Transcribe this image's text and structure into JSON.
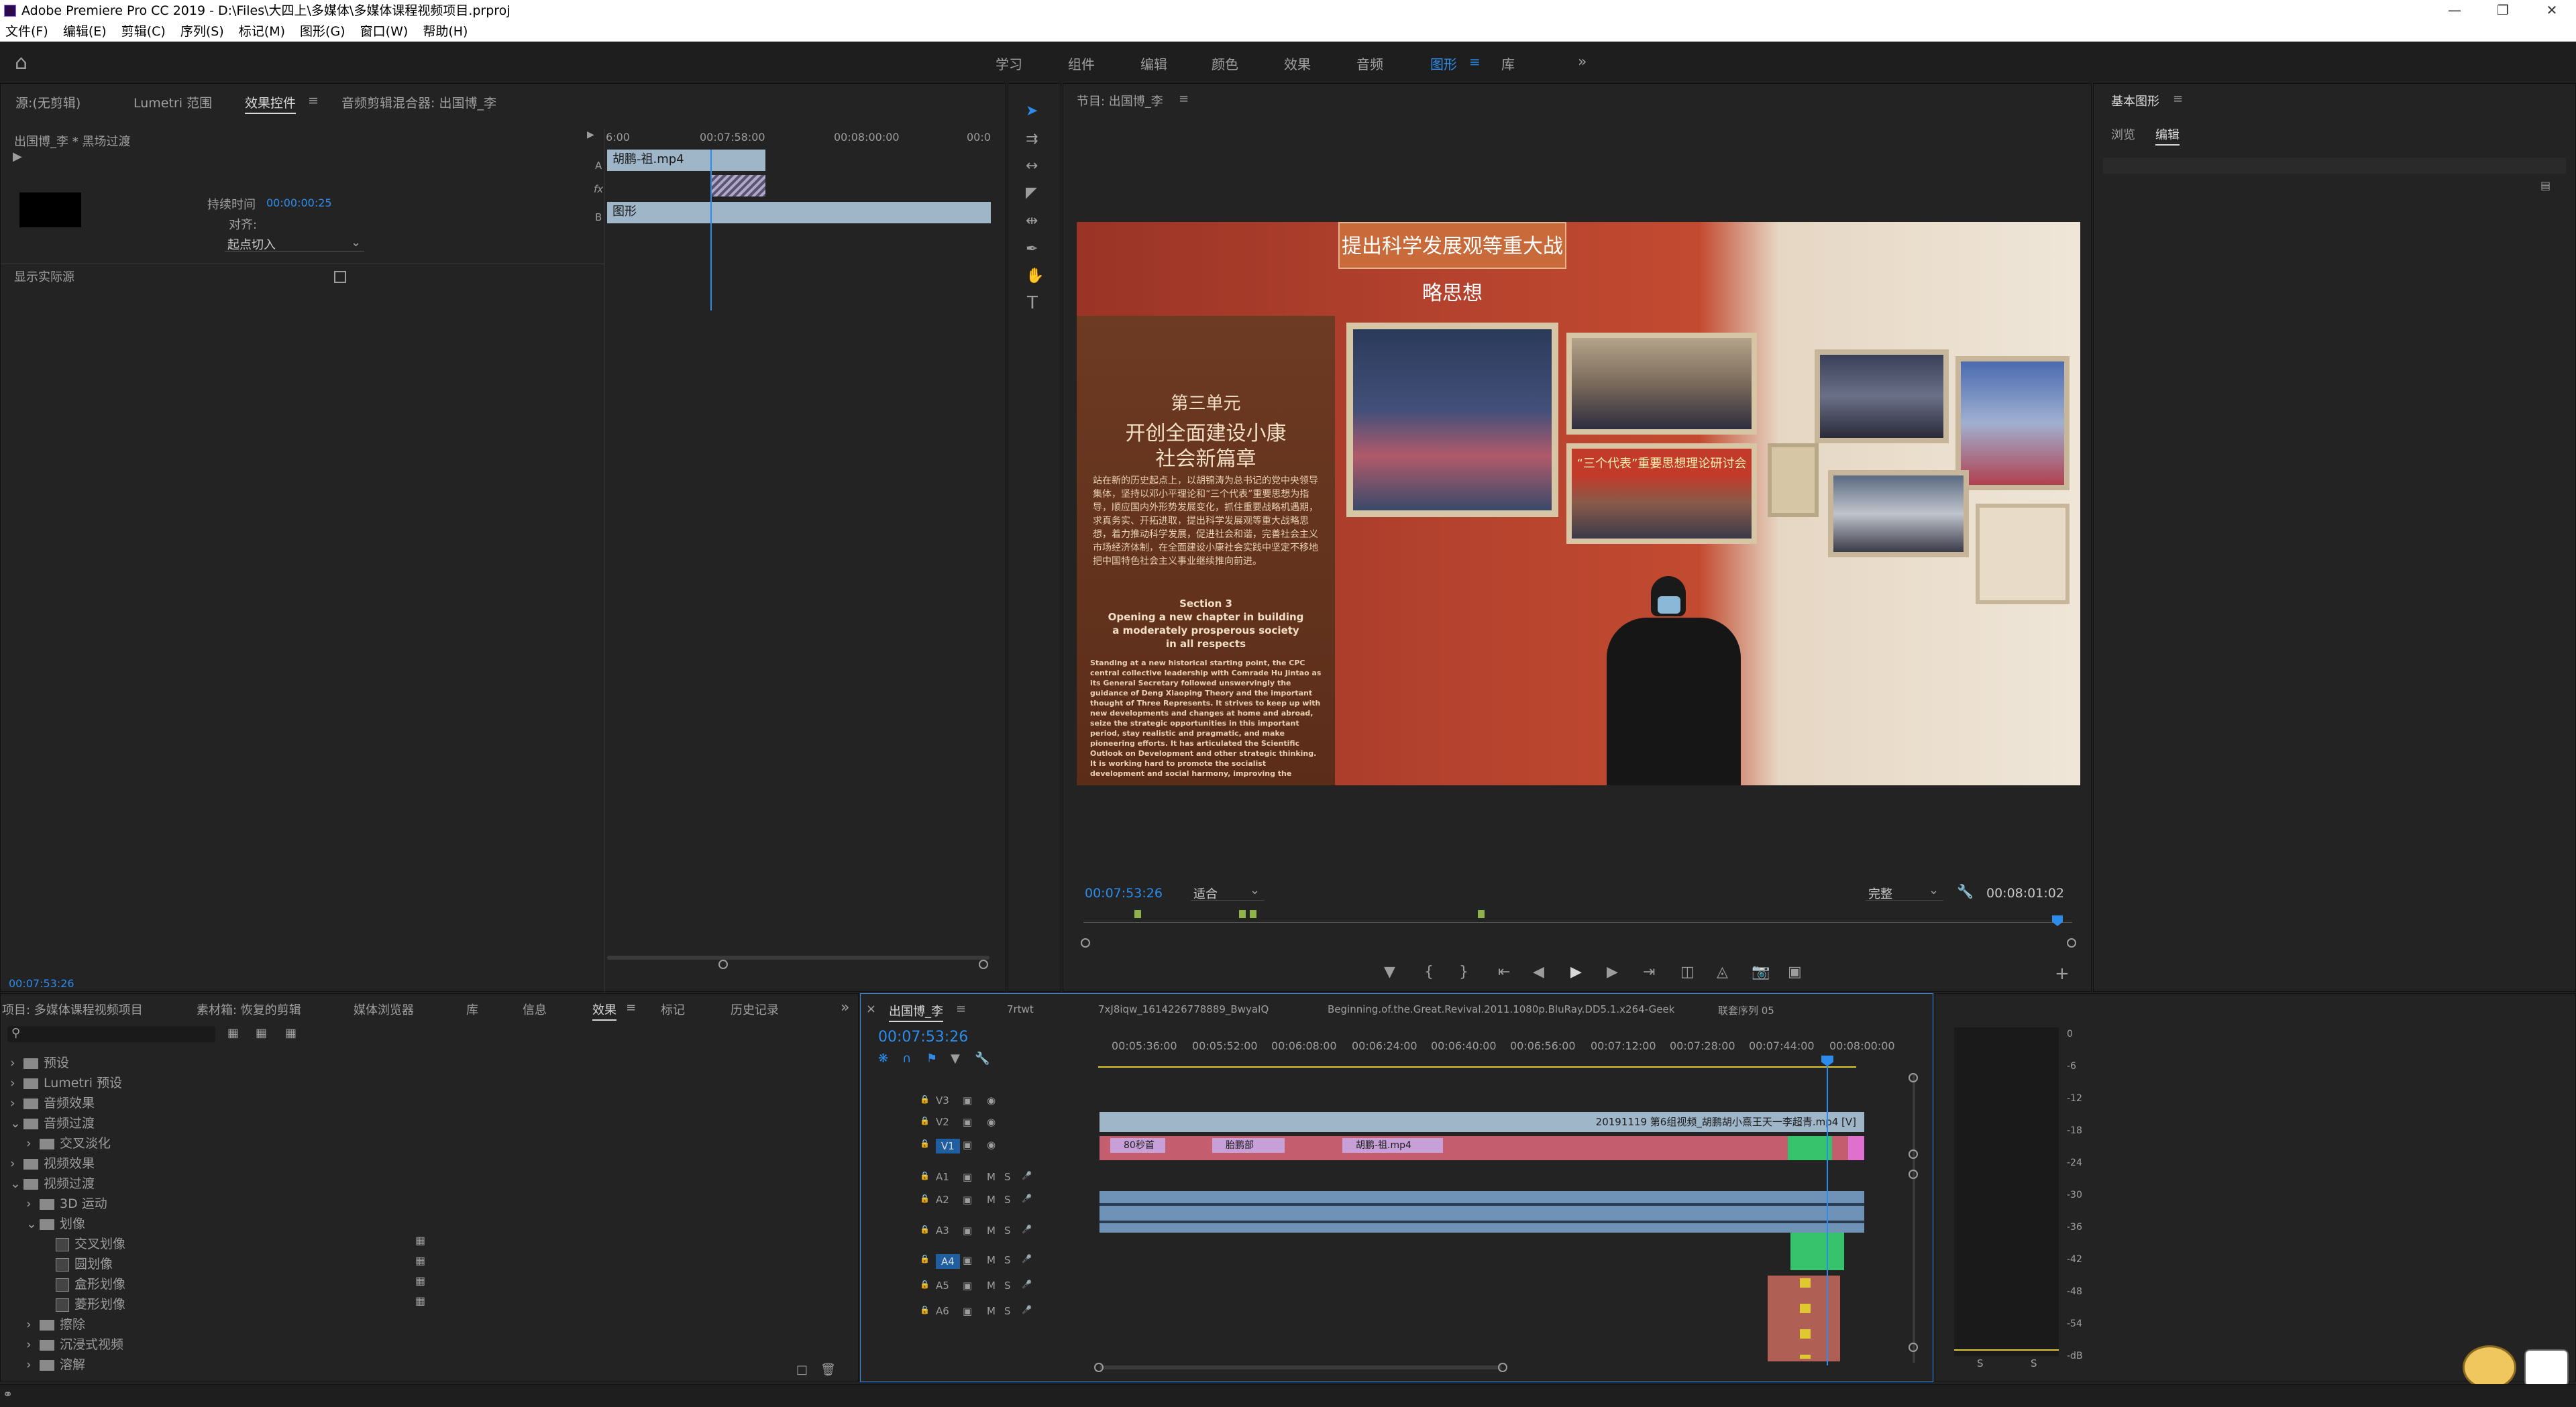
{
  "window": {
    "title": "Adobe Premiere Pro CC 2019 - D:\\Files\\大四上\\多媒体\\多媒体课程视频项目.prproj"
  },
  "menu": [
    "文件(F)",
    "编辑(E)",
    "剪辑(C)",
    "序列(S)",
    "标记(M)",
    "图形(G)",
    "窗口(W)",
    "帮助(H)"
  ],
  "workspaces": [
    "学习",
    "组件",
    "编辑",
    "颜色",
    "效果",
    "音频",
    "图形",
    "库"
  ],
  "workspace_active": "图形",
  "source_tabs": [
    "源:(无剪辑)",
    "Lumetri 范围",
    "效果控件",
    "音频剪辑混合器: 出国博_李"
  ],
  "effect_controls": {
    "clip_path": "出国博_李 * 黑场过渡",
    "duration_label": "持续时间",
    "duration_value": "00:00:00:25",
    "align_label": "对齐:",
    "align_value": "起点切入",
    "show_actual": "显示实际源",
    "timecode": "00:07:53:26",
    "ruler": [
      "6:00",
      "00:07:58:00",
      "00:08:00:00",
      "00:0"
    ],
    "lane_labels": [
      "A",
      "fx",
      "B"
    ],
    "clip_a": "胡鹏-祖.mp4",
    "clip_b": "图形"
  },
  "program": {
    "title": "节目: 出国博_李",
    "timecode": "00:07:53:26",
    "fit": "适合",
    "quality": "完整",
    "duration": "00:08:01:02",
    "video": {
      "banner": "提出科学发展观等重大战略思想",
      "unit": "第三单元",
      "heading1": "开创全面建设小康",
      "heading2": "社会新篇章",
      "body_cn": "站在新的历史起点上，以胡锦涛为总书记的党中央领导集体，坚持以邓小平理论和“三个代表”重要思想为指导，顺应国内外形势发展变化，抓住重要战略机遇期，求真务实、开拓进取，提出科学发展观等重大战略思想，着力推动科学发展，促进社会和谐，完善社会主义市场经济体制，在全面建设小康社会实践中坚定不移地把中国特色社会主义事业继续推向前进。",
      "section": "Section 3",
      "section_title1": "Opening a new chapter in building",
      "section_title2": "a moderately prosperous society",
      "section_title3": "in all respects",
      "body_en": "Standing at a new historical starting point, the CPC central collective leadership with Comrade Hu Jintao as its General Secretary followed unswervingly the guidance of Deng Xiaoping Theory and the important thought of Three Represents. It strives to keep up with new developments and changes at home and abroad, seize the strategic opportunities in this important period, stay realistic and pragmatic, and make pioneering efforts. It has articulated the Scientific Outlook on Development and other strategic thinking. It is working hard to promote the socialist development and social harmony, improving the socialist market economy, and unswervingly carrying forward the great cause of socialism with Chinese characteristics while building a moderately prosperous society in all respects.",
      "red_banner": "“三个代表”重要思想理论研讨会"
    }
  },
  "essential_graphics": {
    "title": "基本图形",
    "tabs": [
      "浏览",
      "编辑"
    ]
  },
  "project_tabs": [
    "项目: 多媒体课程视频项目",
    "素材箱: 恢复的剪辑",
    "媒体浏览器",
    "库",
    "信息",
    "效果",
    "标记",
    "历史记录"
  ],
  "effects_tree": [
    {
      "label": "预设",
      "level": 0,
      "type": "folder"
    },
    {
      "label": "Lumetri 预设",
      "level": 0,
      "type": "folder"
    },
    {
      "label": "音频效果",
      "level": 0,
      "type": "folder"
    },
    {
      "label": "音频过渡",
      "level": 0,
      "type": "folder",
      "open": true
    },
    {
      "label": "交叉淡化",
      "level": 1,
      "type": "folder"
    },
    {
      "label": "视频效果",
      "level": 0,
      "type": "folder"
    },
    {
      "label": "视频过渡",
      "level": 0,
      "type": "folder",
      "open": true
    },
    {
      "label": "3D 运动",
      "level": 1,
      "type": "folder"
    },
    {
      "label": "划像",
      "level": 1,
      "type": "folder",
      "open": true
    },
    {
      "label": "交叉划像",
      "level": 2,
      "type": "preset"
    },
    {
      "label": "圆划像",
      "level": 2,
      "type": "preset"
    },
    {
      "label": "盒形划像",
      "level": 2,
      "type": "preset"
    },
    {
      "label": "菱形划像",
      "level": 2,
      "type": "preset"
    },
    {
      "label": "擦除",
      "level": 1,
      "type": "folder"
    },
    {
      "label": "沉浸式视频",
      "level": 1,
      "type": "folder"
    },
    {
      "label": "溶解",
      "level": 1,
      "type": "folder"
    }
  ],
  "timeline": {
    "tabs": [
      "出国博_李",
      "7rtwt",
      "7xJ8iqw_1614226778889_BwyaIQ",
      "Beginning.of.the.Great.Revival.2011.1080p.BluRay.DD5.1.x264-Geek",
      "联套序列 05"
    ],
    "timecode": "00:07:53:26",
    "ruler": [
      "00:05:36:00",
      "00:05:52:00",
      "00:06:08:00",
      "00:06:24:00",
      "00:06:40:00",
      "00:06:56:00",
      "00:07:12:00",
      "00:07:28:00",
      "00:07:44:00",
      "00:08:00:00"
    ],
    "tracks": [
      "V3",
      "V2",
      "V1",
      "A1",
      "A2",
      "A3",
      "A4",
      "A5",
      "A6"
    ],
    "v2_clip": "20191119 第6组视频_胡鹏胡小熹王天一李超青.mp4 [V]",
    "v1_clips": [
      "80秒首",
      "胎鹏部",
      "胡鹏-祖.mp4"
    ]
  },
  "meter": {
    "scale": [
      "0",
      "-6",
      "-12",
      "-18",
      "-24",
      "-30",
      "-36",
      "-42",
      "-48",
      "-54",
      "-dB"
    ],
    "channels": [
      "S",
      "S"
    ]
  },
  "colors": {
    "accent": "#2d8ceb",
    "video_clip": "#9fb6c9",
    "v1_clip": "#d98aa0",
    "audio_clip": "#7aa3c8",
    "green": "#36c36b"
  }
}
